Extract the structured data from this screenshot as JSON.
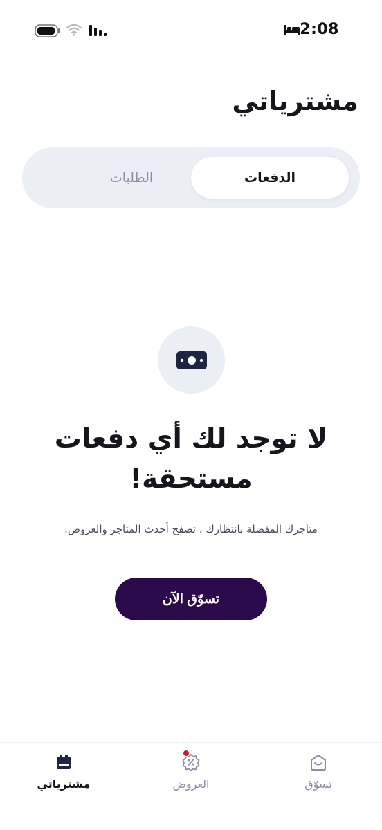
{
  "status_bar": {
    "time": "2:08",
    "icons": [
      "battery-icon",
      "wifi-icon",
      "signal-icon",
      "bed-icon"
    ]
  },
  "header": {
    "title": "مشترياتي"
  },
  "tabs": [
    {
      "label": "الدفعات",
      "active": true
    },
    {
      "label": "الطلبات",
      "active": false
    }
  ],
  "empty_state": {
    "icon": "cash-icon",
    "title": "لا توجد لك أي دفعات مستحقة!",
    "subtitle": "متاجرك المفضلة بانتظارك ، تصفح أحدث المتاجر والعروض.",
    "button_label": "تسوّق الآن"
  },
  "bottom_nav": {
    "items": [
      {
        "label": "مشترياتي",
        "icon": "purchases-icon",
        "active": true
      },
      {
        "label": "العروض",
        "icon": "offers-icon",
        "active": false,
        "has_badge": true
      },
      {
        "label": "تسوّق",
        "icon": "shop-icon",
        "active": false
      }
    ]
  },
  "colors": {
    "primary_button": "#2a0a4a",
    "badge": "#d1192b",
    "muted_text": "#8a8da6",
    "surface": "#eceef5"
  }
}
